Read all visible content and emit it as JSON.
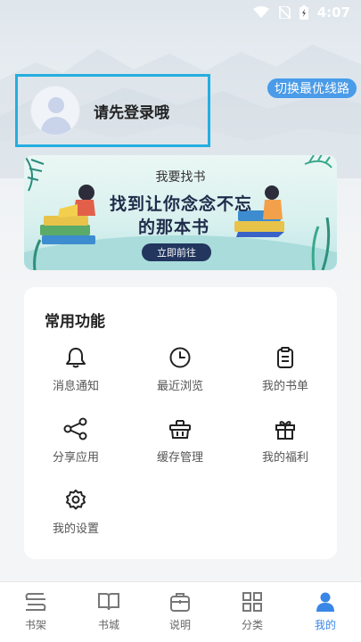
{
  "status_bar": {
    "time": "4:07"
  },
  "header": {
    "route_button": "切换最优线路",
    "login_prompt": "请先登录哦"
  },
  "banner": {
    "subtitle": "我要找书",
    "title_line1": "找到让你念念不忘",
    "title_line2": "的那本书",
    "button": "立即前往"
  },
  "functions": {
    "title": "常用功能",
    "items": [
      {
        "label": "消息通知",
        "icon": "bell-icon"
      },
      {
        "label": "最近浏览",
        "icon": "clock-icon"
      },
      {
        "label": "我的书单",
        "icon": "clipboard-icon"
      },
      {
        "label": "分享应用",
        "icon": "share-icon"
      },
      {
        "label": "缓存管理",
        "icon": "basket-icon"
      },
      {
        "label": "我的福利",
        "icon": "gift-icon"
      },
      {
        "label": "我的设置",
        "icon": "gear-icon"
      }
    ]
  },
  "tabbar": {
    "tabs": [
      {
        "label": "书架",
        "icon": "bookshelf-icon"
      },
      {
        "label": "书城",
        "icon": "open-book-icon"
      },
      {
        "label": "说明",
        "icon": "briefcase-icon"
      },
      {
        "label": "分类",
        "icon": "grid-icon"
      },
      {
        "label": "我的",
        "icon": "person-icon",
        "active": true
      }
    ],
    "active_color": "#3a86e6"
  },
  "colors": {
    "accent": "#4a9be8",
    "highlight_border": "#24aee0"
  }
}
